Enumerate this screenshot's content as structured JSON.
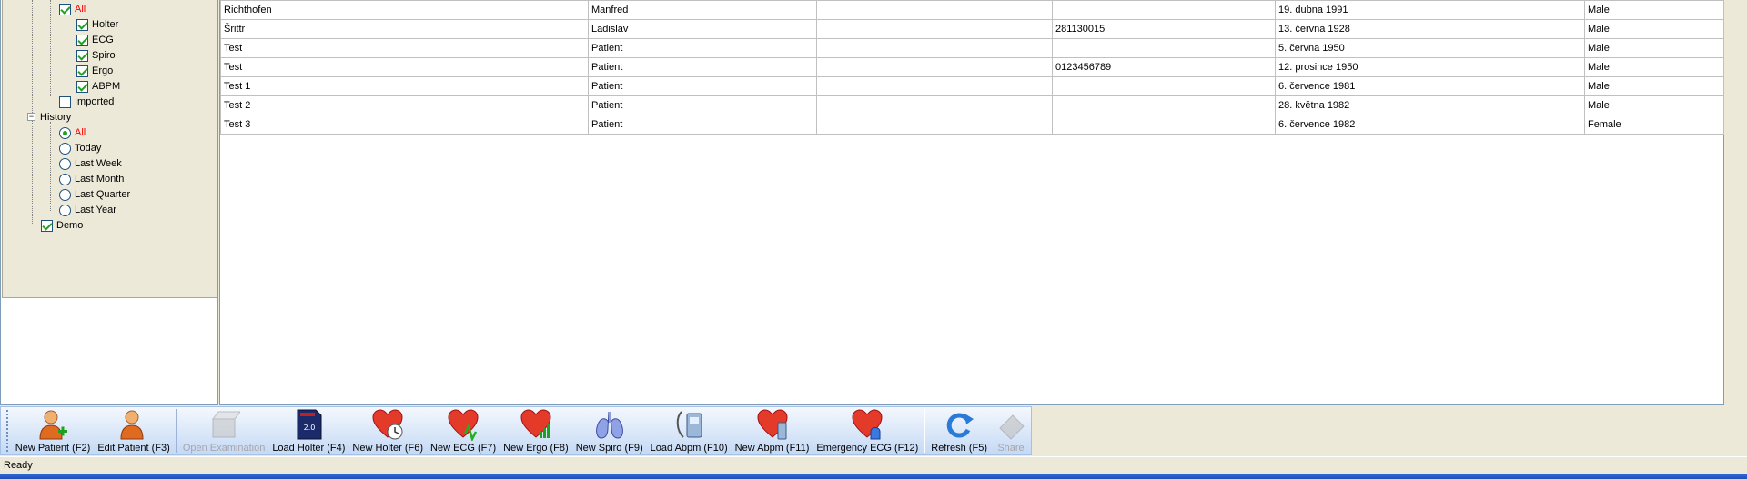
{
  "tree": {
    "exam_items": [
      {
        "label": "All",
        "checked": true,
        "highlight": true
      },
      {
        "label": "Holter",
        "checked": true
      },
      {
        "label": "ECG",
        "checked": true
      },
      {
        "label": "Spiro",
        "checked": true
      },
      {
        "label": "Ergo",
        "checked": true
      },
      {
        "label": "ABPM",
        "checked": true
      }
    ],
    "imported": {
      "label": "Imported",
      "checked": false
    },
    "history": {
      "label": "History",
      "options": [
        {
          "label": "All",
          "selected": true
        },
        {
          "label": "Today",
          "selected": false
        },
        {
          "label": "Last Week",
          "selected": false
        },
        {
          "label": "Last Month",
          "selected": false
        },
        {
          "label": "Last Quarter",
          "selected": false
        },
        {
          "label": "Last Year",
          "selected": false
        }
      ]
    },
    "demo": {
      "label": "Demo",
      "checked": true
    }
  },
  "grid": {
    "rows": [
      [
        "Richthofen",
        "Manfred",
        "",
        "",
        "19. dubna 1991",
        "Male"
      ],
      [
        "Šrittr",
        "Ladislav",
        "",
        "281130015",
        "13. června 1928",
        "Male"
      ],
      [
        "Test",
        "Patient",
        "",
        "",
        "5. června 1950",
        "Male"
      ],
      [
        "Test",
        "Patient",
        "",
        "0123456789",
        "12. prosince 1950",
        "Male"
      ],
      [
        "Test 1",
        "Patient",
        "",
        "",
        "6. července 1981",
        "Male"
      ],
      [
        "Test 2",
        "Patient",
        "",
        "",
        "28. května 1982",
        "Male"
      ],
      [
        "Test 3",
        "Patient",
        "",
        "",
        "6. července 1982",
        "Female"
      ]
    ]
  },
  "toolbar": {
    "buttons": [
      {
        "label": "New Patient (F2)",
        "icon": "new-patient-icon",
        "enabled": true
      },
      {
        "label": "Edit Patient (F3)",
        "icon": "edit-patient-icon",
        "enabled": true
      },
      {
        "label": "Open Examination",
        "icon": "open-examination-icon",
        "enabled": false
      },
      {
        "label": "Load Holter (F4)",
        "icon": "sd-card-icon",
        "enabled": true
      },
      {
        "label": "New Holter (F6)",
        "icon": "heart-clock-icon",
        "enabled": true
      },
      {
        "label": "New ECG (F7)",
        "icon": "heart-ecg-icon",
        "enabled": true
      },
      {
        "label": "New Ergo (F8)",
        "icon": "heart-ergo-icon",
        "enabled": true
      },
      {
        "label": "New Spiro (F9)",
        "icon": "lungs-icon",
        "enabled": true
      },
      {
        "label": "Load Abpm (F10)",
        "icon": "abpm-device-icon",
        "enabled": true
      },
      {
        "label": "New Abpm (F11)",
        "icon": "heart-abpm-icon",
        "enabled": true
      },
      {
        "label": "Emergency ECG (F12)",
        "icon": "heart-siren-icon",
        "enabled": true
      },
      {
        "label": "Refresh (F5)",
        "icon": "refresh-icon",
        "enabled": true
      },
      {
        "label": "Share",
        "icon": "share-icon",
        "enabled": false
      }
    ]
  },
  "status": {
    "text": "Ready"
  },
  "colors": {
    "accent_red": "#ff0000",
    "check_green": "#21a121",
    "toolbar_blue": "#c4d9f5"
  }
}
